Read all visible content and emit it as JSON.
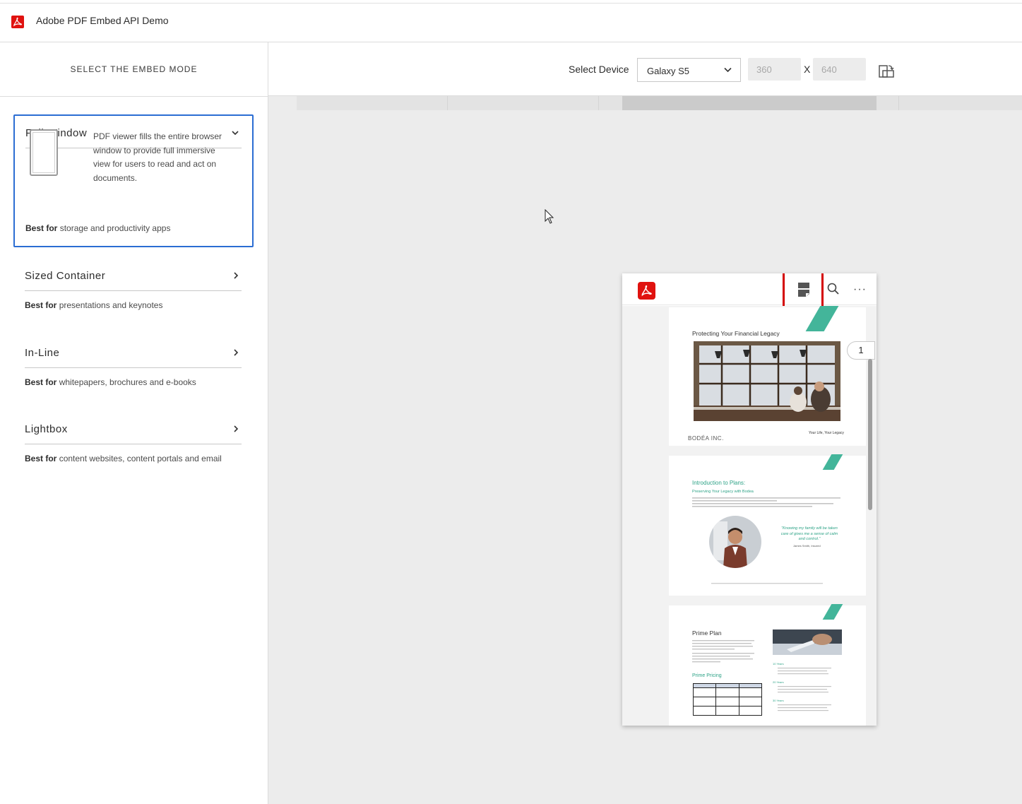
{
  "app": {
    "title": "Adobe PDF Embed API Demo",
    "logo_icon": "adobe-acrobat-icon",
    "brand_color": "#e0120f"
  },
  "sidebar": {
    "heading": "SELECT THE EMBED MODE",
    "modes": [
      {
        "title": "Full Window",
        "expanded": true,
        "description": "PDF viewer fills the entire browser window to provide full immersive view for users to read and act on documents.",
        "best_for_label": "Best for",
        "best_for": "storage and productivity apps"
      },
      {
        "title": "Sized Container",
        "expanded": false,
        "best_for_label": "Best for",
        "best_for": "presentations and keynotes"
      },
      {
        "title": "In-Line",
        "expanded": false,
        "best_for_label": "Best for",
        "best_for": "whitepapers, brochures and e-books"
      },
      {
        "title": "Lightbox",
        "expanded": false,
        "best_for_label": "Best for",
        "best_for": "content websites, content portals and email"
      }
    ]
  },
  "toolbar": {
    "select_label": "Select Device",
    "device": "Galaxy S5",
    "width": "360",
    "height": "640",
    "separator": "X",
    "rotate_icon": "rotate-device-icon"
  },
  "viewer": {
    "page_number": "1",
    "more_label": "···",
    "accent_color": "#43b59a",
    "highlight_color": "#d40000",
    "page1": {
      "heading": "Protecting Your Financial Legacy",
      "brand": "BODÉA INC.",
      "tagline": "Your Life, Your Legacy"
    },
    "page2": {
      "heading": "Introduction to Plans:",
      "subheading": "Preserving Your Legacy with Bodea",
      "quote": "\"Knowing my family will be taken care of gives me a sense of calm and control.\"",
      "quote_author": "James Smith, Insured"
    },
    "page3": {
      "heading": "Prime Plan",
      "pricing_heading": "Prime Pricing",
      "term_labels": [
        "10 Years",
        "20 Years",
        "30 Years"
      ]
    }
  }
}
